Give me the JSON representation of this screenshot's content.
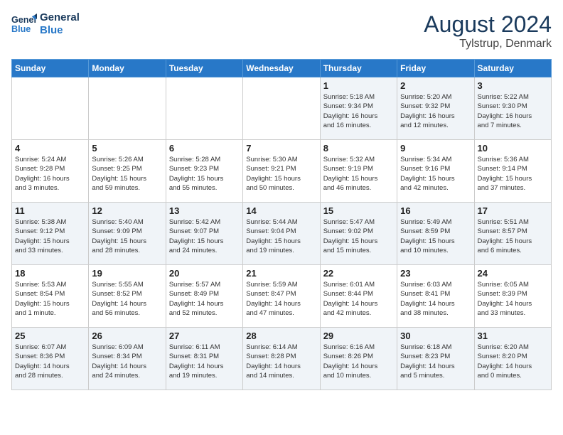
{
  "header": {
    "logo_line1": "General",
    "logo_line2": "Blue",
    "month": "August 2024",
    "location": "Tylstrup, Denmark"
  },
  "weekdays": [
    "Sunday",
    "Monday",
    "Tuesday",
    "Wednesday",
    "Thursday",
    "Friday",
    "Saturday"
  ],
  "weeks": [
    [
      {
        "day": "",
        "info": ""
      },
      {
        "day": "",
        "info": ""
      },
      {
        "day": "",
        "info": ""
      },
      {
        "day": "",
        "info": ""
      },
      {
        "day": "1",
        "info": "Sunrise: 5:18 AM\nSunset: 9:34 PM\nDaylight: 16 hours\nand 16 minutes."
      },
      {
        "day": "2",
        "info": "Sunrise: 5:20 AM\nSunset: 9:32 PM\nDaylight: 16 hours\nand 12 minutes."
      },
      {
        "day": "3",
        "info": "Sunrise: 5:22 AM\nSunset: 9:30 PM\nDaylight: 16 hours\nand 7 minutes."
      }
    ],
    [
      {
        "day": "4",
        "info": "Sunrise: 5:24 AM\nSunset: 9:28 PM\nDaylight: 16 hours\nand 3 minutes."
      },
      {
        "day": "5",
        "info": "Sunrise: 5:26 AM\nSunset: 9:25 PM\nDaylight: 15 hours\nand 59 minutes."
      },
      {
        "day": "6",
        "info": "Sunrise: 5:28 AM\nSunset: 9:23 PM\nDaylight: 15 hours\nand 55 minutes."
      },
      {
        "day": "7",
        "info": "Sunrise: 5:30 AM\nSunset: 9:21 PM\nDaylight: 15 hours\nand 50 minutes."
      },
      {
        "day": "8",
        "info": "Sunrise: 5:32 AM\nSunset: 9:19 PM\nDaylight: 15 hours\nand 46 minutes."
      },
      {
        "day": "9",
        "info": "Sunrise: 5:34 AM\nSunset: 9:16 PM\nDaylight: 15 hours\nand 42 minutes."
      },
      {
        "day": "10",
        "info": "Sunrise: 5:36 AM\nSunset: 9:14 PM\nDaylight: 15 hours\nand 37 minutes."
      }
    ],
    [
      {
        "day": "11",
        "info": "Sunrise: 5:38 AM\nSunset: 9:12 PM\nDaylight: 15 hours\nand 33 minutes."
      },
      {
        "day": "12",
        "info": "Sunrise: 5:40 AM\nSunset: 9:09 PM\nDaylight: 15 hours\nand 28 minutes."
      },
      {
        "day": "13",
        "info": "Sunrise: 5:42 AM\nSunset: 9:07 PM\nDaylight: 15 hours\nand 24 minutes."
      },
      {
        "day": "14",
        "info": "Sunrise: 5:44 AM\nSunset: 9:04 PM\nDaylight: 15 hours\nand 19 minutes."
      },
      {
        "day": "15",
        "info": "Sunrise: 5:47 AM\nSunset: 9:02 PM\nDaylight: 15 hours\nand 15 minutes."
      },
      {
        "day": "16",
        "info": "Sunrise: 5:49 AM\nSunset: 8:59 PM\nDaylight: 15 hours\nand 10 minutes."
      },
      {
        "day": "17",
        "info": "Sunrise: 5:51 AM\nSunset: 8:57 PM\nDaylight: 15 hours\nand 6 minutes."
      }
    ],
    [
      {
        "day": "18",
        "info": "Sunrise: 5:53 AM\nSunset: 8:54 PM\nDaylight: 15 hours\nand 1 minute."
      },
      {
        "day": "19",
        "info": "Sunrise: 5:55 AM\nSunset: 8:52 PM\nDaylight: 14 hours\nand 56 minutes."
      },
      {
        "day": "20",
        "info": "Sunrise: 5:57 AM\nSunset: 8:49 PM\nDaylight: 14 hours\nand 52 minutes."
      },
      {
        "day": "21",
        "info": "Sunrise: 5:59 AM\nSunset: 8:47 PM\nDaylight: 14 hours\nand 47 minutes."
      },
      {
        "day": "22",
        "info": "Sunrise: 6:01 AM\nSunset: 8:44 PM\nDaylight: 14 hours\nand 42 minutes."
      },
      {
        "day": "23",
        "info": "Sunrise: 6:03 AM\nSunset: 8:41 PM\nDaylight: 14 hours\nand 38 minutes."
      },
      {
        "day": "24",
        "info": "Sunrise: 6:05 AM\nSunset: 8:39 PM\nDaylight: 14 hours\nand 33 minutes."
      }
    ],
    [
      {
        "day": "25",
        "info": "Sunrise: 6:07 AM\nSunset: 8:36 PM\nDaylight: 14 hours\nand 28 minutes."
      },
      {
        "day": "26",
        "info": "Sunrise: 6:09 AM\nSunset: 8:34 PM\nDaylight: 14 hours\nand 24 minutes."
      },
      {
        "day": "27",
        "info": "Sunrise: 6:11 AM\nSunset: 8:31 PM\nDaylight: 14 hours\nand 19 minutes."
      },
      {
        "day": "28",
        "info": "Sunrise: 6:14 AM\nSunset: 8:28 PM\nDaylight: 14 hours\nand 14 minutes."
      },
      {
        "day": "29",
        "info": "Sunrise: 6:16 AM\nSunset: 8:26 PM\nDaylight: 14 hours\nand 10 minutes."
      },
      {
        "day": "30",
        "info": "Sunrise: 6:18 AM\nSunset: 8:23 PM\nDaylight: 14 hours\nand 5 minutes."
      },
      {
        "day": "31",
        "info": "Sunrise: 6:20 AM\nSunset: 8:20 PM\nDaylight: 14 hours\nand 0 minutes."
      }
    ]
  ]
}
